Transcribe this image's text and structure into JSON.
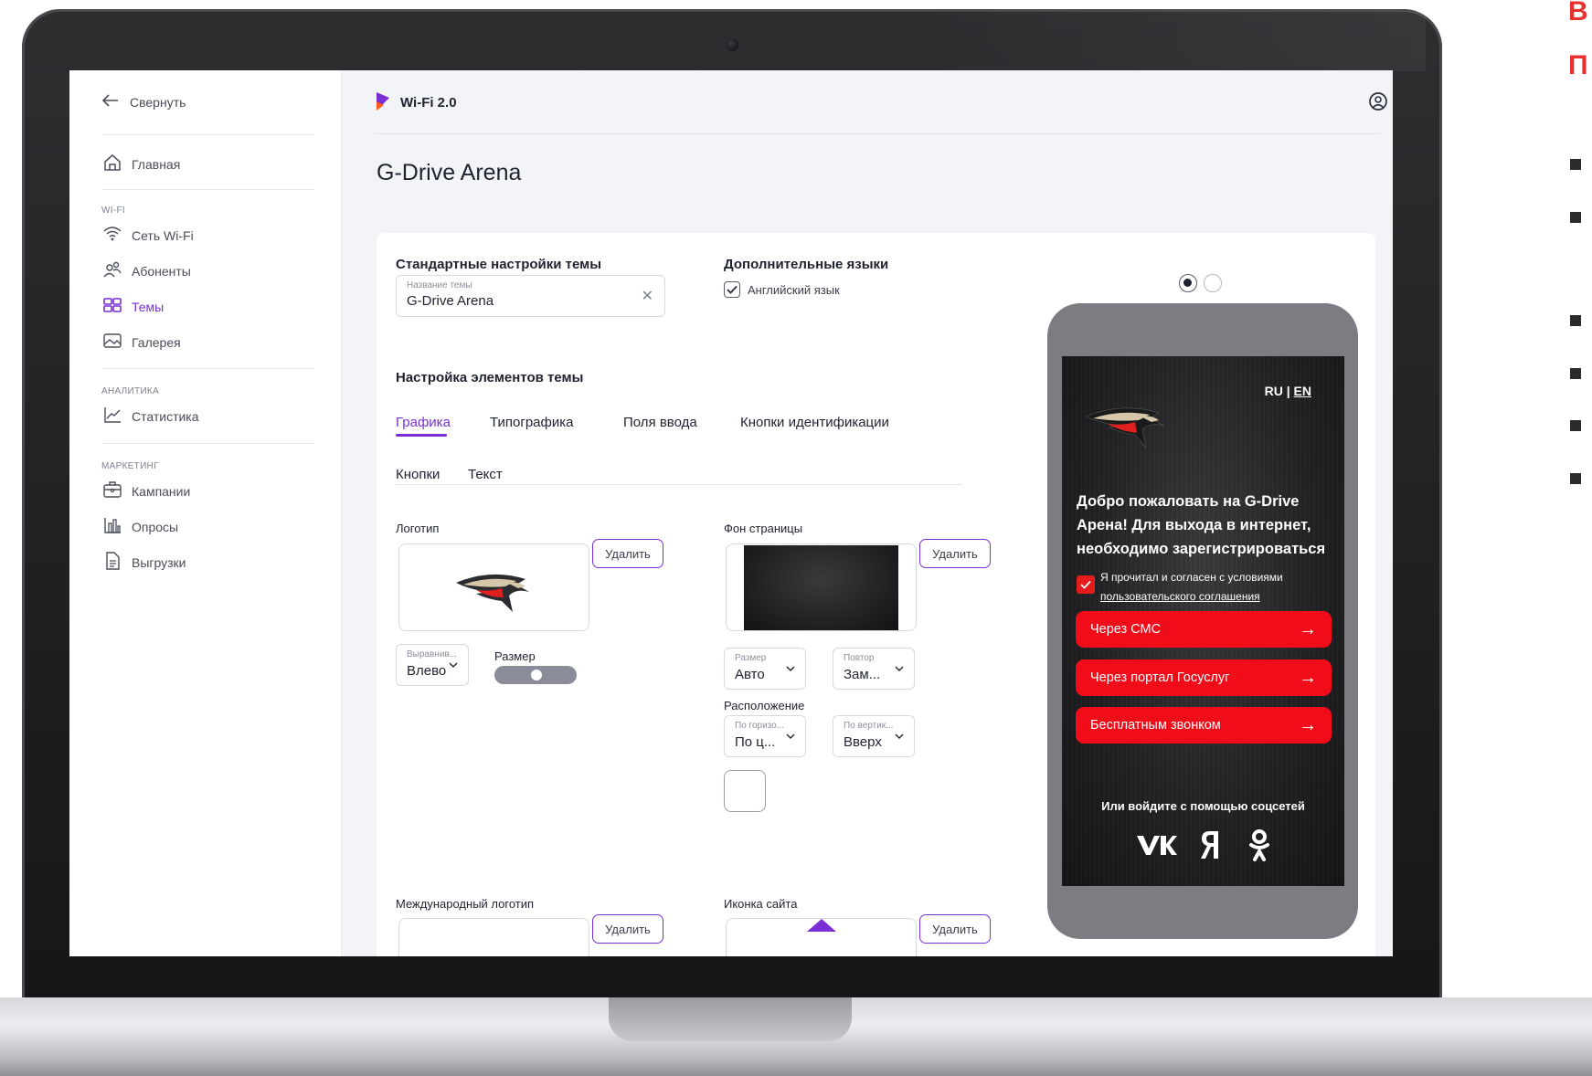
{
  "app": {
    "name": "Wi-Fi 2.0",
    "brand_color": "#7a2fd6"
  },
  "sidebar": {
    "collapse_label": "Свернуть",
    "home_label": "Главная",
    "sections": {
      "wifi": "WI-FI",
      "analytics": "АНАЛИТИКА",
      "marketing": "МАРКЕТИНГ"
    },
    "items": {
      "network": "Сеть Wi-Fi",
      "subscribers": "Абоненты",
      "themes": "Темы",
      "gallery": "Галерея",
      "statistics": "Статистика",
      "campaigns": "Кампании",
      "polls": "Опросы",
      "exports": "Выгрузки"
    }
  },
  "page": {
    "title": "G-Drive Arena"
  },
  "theme_settings": {
    "standard_heading": "Стандартные настройки темы",
    "name_field": {
      "caption": "Название темы",
      "value": "G-Drive Arena"
    },
    "extra_languages_heading": "Дополнительные языки",
    "english_label": "Английский язык",
    "elements_heading": "Настройка элементов темы",
    "tabs": [
      "Графика",
      "Типографика",
      "Поля ввода",
      "Кнопки идентификации"
    ],
    "subtabs": [
      "Кнопки",
      "Текст"
    ]
  },
  "graphics": {
    "logo_label": "Логотип",
    "delete_label": "Удалить",
    "align": {
      "caption": "Выравнив...",
      "value": "Влево"
    },
    "size_label": "Размер",
    "background_label": "Фон страницы",
    "bg_size": {
      "caption": "Размер",
      "value": "Авто"
    },
    "bg_repeat": {
      "caption": "Повтор",
      "value": "Зам..."
    },
    "position_label": "Расположение",
    "bg_horizontal": {
      "caption": "По горизо...",
      "value": "По ц..."
    },
    "bg_vertical": {
      "caption": "По вертик...",
      "value": "Вверх"
    },
    "intl_logo_label": "Международный логотип",
    "favicon_label": "Иконка сайта"
  },
  "phone_preview": {
    "lang_ru": "RU",
    "lang_sep": "|",
    "lang_en": "EN",
    "welcome": "Добро пожаловать на G-Drive Арена! Для выхода в интернет, необходимо зарегистрироваться",
    "agree_prefix": "Я прочитал и согласен с условиями",
    "agree_link": "пользовательского соглашения",
    "buttons": [
      "Через СМС",
      "Через портал Госуслуг",
      "Бесплатным звонком"
    ],
    "arrow": "→",
    "social_caption": "Или войдите с помощью соцсетей",
    "socials": [
      "vk",
      "yandex",
      "odnoklassniki"
    ],
    "accent_color": "#f00c18"
  },
  "slide_fragment": {
    "line1": "В",
    "line2": "П"
  }
}
